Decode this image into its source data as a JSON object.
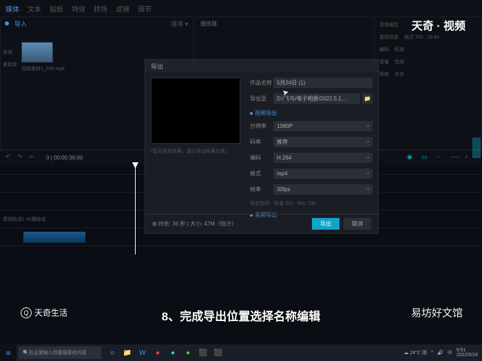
{
  "topbar": {
    "tabs": [
      "媒体",
      "文本",
      "贴纸",
      "特效",
      "转场",
      "滤镜",
      "调节"
    ]
  },
  "media": {
    "import": "导入",
    "sort": "排序 ▾",
    "caption": "视频素材1_039 mp4",
    "side1": "本地",
    "side2": "素材库"
  },
  "preview": {
    "title": "播放器"
  },
  "info": {
    "title": "音频属性",
    "r1k": "基础信息",
    "r1v": "格式 SDI : 16-bit",
    "r2k": "编码",
    "r2v": "标准",
    "r3k": "音量",
    "r3v": "在线",
    "r4k": "降噪",
    "r4v": "也许"
  },
  "watermark": {
    "top": "天奇 · 视频",
    "bl": "天奇生活",
    "br": "易坊好文馆"
  },
  "dialog": {
    "title": "导出",
    "name_lbl": "作品名称",
    "name_val": "5月24日 (1)",
    "path_lbl": "导出至",
    "path_val": "D:/飞鸟/电子相册/2022.5.1…",
    "video_section": "视频导出",
    "res_lbl": "分辨率",
    "res_val": "1080P",
    "rate_lbl": "码率",
    "rate_val": "推荐",
    "codec_lbl": "编码",
    "codec_val": "H.264",
    "fmt_lbl": "格式",
    "fmt_val": "mp4",
    "fps_lbl": "帧率",
    "fps_val": "30fps",
    "meta": "色彩空间：标准 SDI - Rec.709",
    "audio_section": "音频导出",
    "footer": "时长: 36 秒 | 大小: 47M（估计）",
    "export_btn": "导出",
    "cancel_btn": "取消"
  },
  "timeline": {
    "t1": "0",
    "t2": "00:00:36:00",
    "track": "音频轨道1 42播放成"
  },
  "caption": "8、完成导出位置选择名称编辑",
  "taskbar": {
    "search": "在这里输入你要搜索的内容",
    "temp": "24°C 阴",
    "time": "9:51",
    "date": "2022/5/24"
  }
}
